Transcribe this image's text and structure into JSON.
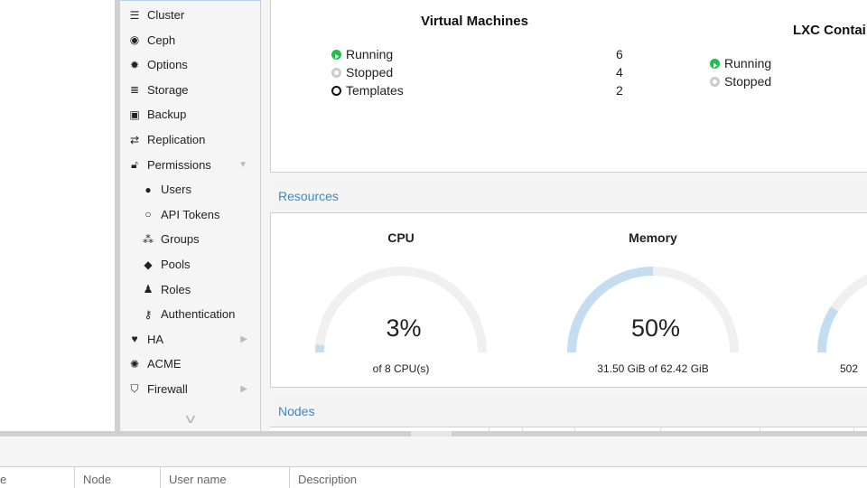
{
  "sidebar": {
    "items": [
      {
        "label": "Cluster",
        "icon": "server-icon"
      },
      {
        "label": "Ceph",
        "icon": "ceph-icon"
      },
      {
        "label": "Options",
        "icon": "gear-icon"
      },
      {
        "label": "Storage",
        "icon": "database-icon"
      },
      {
        "label": "Backup",
        "icon": "floppy-icon"
      },
      {
        "label": "Replication",
        "icon": "retweet-icon"
      },
      {
        "label": "Permissions",
        "icon": "unlock-icon",
        "expanded": true
      },
      {
        "label": "Users",
        "icon": "user-icon"
      },
      {
        "label": "API Tokens",
        "icon": "user-outline-icon"
      },
      {
        "label": "Groups",
        "icon": "users-icon"
      },
      {
        "label": "Pools",
        "icon": "tags-icon"
      },
      {
        "label": "Roles",
        "icon": "male-icon"
      },
      {
        "label": "Authentication",
        "icon": "key-icon"
      },
      {
        "label": "HA",
        "icon": "heartbeat-icon"
      },
      {
        "label": "ACME",
        "icon": "certificate-icon"
      },
      {
        "label": "Firewall",
        "icon": "shield-icon"
      }
    ]
  },
  "guests": {
    "vm": {
      "title": "Virtual Machines",
      "rows": [
        {
          "label": "Running",
          "count": "6"
        },
        {
          "label": "Stopped",
          "count": "4"
        },
        {
          "label": "Templates",
          "count": "2"
        }
      ]
    },
    "lxc": {
      "title": "LXC Contai",
      "rows": [
        {
          "label": "Running"
        },
        {
          "label": "Stopped"
        }
      ]
    }
  },
  "resources": {
    "header": "Resources",
    "cpu": {
      "title": "CPU",
      "percent": "3%",
      "value": 3,
      "sub": "of 8 CPU(s)"
    },
    "memory": {
      "title": "Memory",
      "percent": "50%",
      "value": 50,
      "sub": "31.50 GiB of 62.42 GiB"
    },
    "third": {
      "value": 18,
      "sub": "502"
    }
  },
  "nodes": {
    "header": "Nodes"
  },
  "bottom_grid": {
    "columns": [
      "e",
      "Node",
      "User name",
      "Description"
    ]
  },
  "colors": {
    "accent": "#3a8ac6",
    "running": "#21bf4b",
    "gauge": "#c5ddf1",
    "gauge_track": "#f0f0f0"
  }
}
